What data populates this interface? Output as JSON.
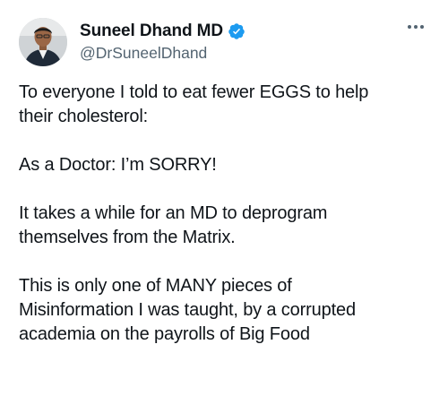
{
  "author": {
    "display_name": "Suneel Dhand MD",
    "handle": "@DrSuneelDhand",
    "verified": true,
    "verified_color": "#1d9bf0"
  },
  "icons": {
    "verified": "verified-badge-icon",
    "more": "more-options-icon"
  },
  "tweet": {
    "paragraphs": [
      [
        "To everyone I told to eat fewer EGGS to help",
        "their cholesterol:"
      ],
      [
        "As a Doctor: I’m SORRY!"
      ],
      [
        "It takes a while for an MD to deprogram",
        "themselves from the Matrix."
      ],
      [
        "This is only one of MANY pieces of",
        "Misinformation I was taught, by a corrupted",
        "academia on the payrolls of Big Food"
      ]
    ]
  }
}
